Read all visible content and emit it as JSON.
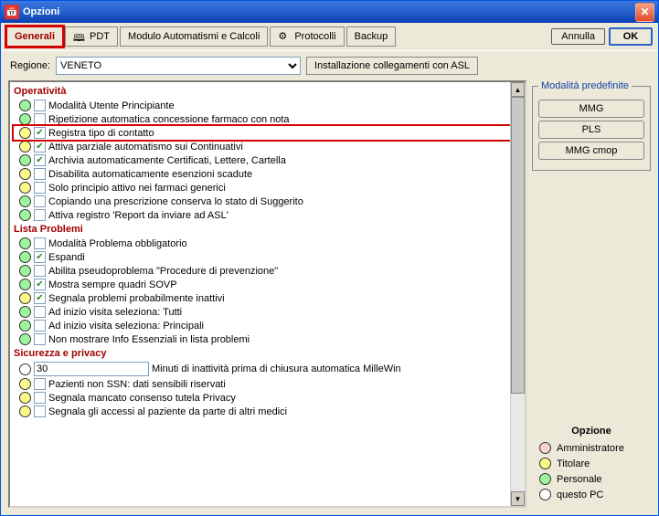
{
  "window": {
    "title": "Opzioni"
  },
  "buttons": {
    "cancel": "Annulla",
    "ok": "OK"
  },
  "tabs": {
    "generali": "Generali",
    "pdt": "PDT",
    "modulo": "Modulo Automatismi e Calcoli",
    "protocolli": "Protocolli",
    "backup": "Backup"
  },
  "region": {
    "label": "Regione:",
    "value": "VENETO",
    "asl_button": "Installazione collegamenti con ASL"
  },
  "preset_group": {
    "legend": "Modalità predefinite",
    "mmg": "MMG",
    "pls": "PLS",
    "mmg_cmop": "MMG cmop"
  },
  "sections": {
    "operativita": "Operatività",
    "lista_problemi": "Lista Problemi",
    "sicurezza": "Sicurezza e privacy"
  },
  "items": {
    "op1": "Modalità Utente Principiante",
    "op2": "Ripetizione automatica concessione farmaco con nota",
    "op3": "Registra tipo di contatto",
    "op4": "Attiva parziale automatismo sui Continuativi",
    "op5": "Archivia automaticamente Certificati, Lettere, Cartella",
    "op6": "Disabilita automaticamente esenzioni scadute",
    "op7": "Solo principio attivo nei farmaci generici",
    "op8": "Copiando una prescrizione conserva lo stato di Suggerito",
    "op9": "Attiva registro 'Report da inviare ad ASL'",
    "lp1": "Modalità Problema obbligatorio",
    "lp2": "Espandi",
    "lp3": "Abilita pseudoproblema \"Procedure di prevenzione\"",
    "lp4": "Mostra sempre quadri SOVP",
    "lp5": "Segnala problemi probabilmente inattivi",
    "lp6": "Ad inizio visita seleziona: Tutti",
    "lp7": "Ad inizio visita seleziona: Principali",
    "lp8": "Non mostrare Info Essenziali in lista problemi",
    "sp_min_value": "30",
    "sp_min_suffix": "Minuti di inattività prima di chiusura automatica MilleWin",
    "sp2": "Pazienti non SSN: dati sensibili riservati",
    "sp3": "Segnala mancato consenso tutela Privacy",
    "sp4": "Segnala gli accessi al paziente da parte di altri medici"
  },
  "legend": {
    "title": "Opzione",
    "admin": "Amministratore",
    "titolare": "Titolare",
    "personale": "Personale",
    "questopc": "questo PC"
  }
}
